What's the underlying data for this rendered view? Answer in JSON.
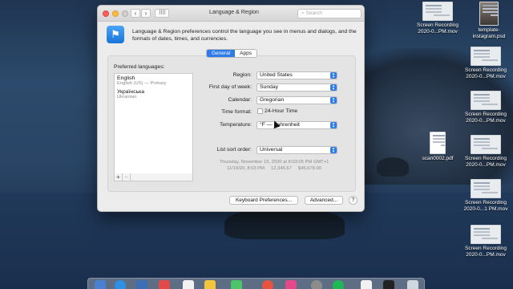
{
  "window": {
    "title": "Language & Region",
    "search_placeholder": "Search",
    "back_glyph": "‹",
    "forward_glyph": "›",
    "grid_glyph": "⠿⠿",
    "header_icon": "flag-globe-icon",
    "header_text": "Language & Region preferences control the language you see in menus and dialogs, and the formats of dates, times, and currencies."
  },
  "tabs": [
    {
      "label": "General",
      "active": true
    },
    {
      "label": "Apps",
      "active": false
    }
  ],
  "preferred_languages": {
    "label": "Preferred languages:",
    "items": [
      {
        "name": "English",
        "detail": "English (US) — Primary"
      },
      {
        "name": "Українська",
        "detail": "Ukrainian"
      }
    ],
    "add_glyph": "+",
    "remove_glyph": "−"
  },
  "settings": {
    "region": {
      "label": "Region:",
      "value": "United States"
    },
    "first_day": {
      "label": "First day of week:",
      "value": "Sunday"
    },
    "calendar": {
      "label": "Calendar:",
      "value": "Gregorian"
    },
    "time_format": {
      "label": "Time format:",
      "checkbox_label": "24-Hour Time",
      "checked": false
    },
    "temperature": {
      "label": "Temperature:",
      "value": "°F — Fahrenheit"
    },
    "list_sort": {
      "label": "List sort order:",
      "value": "Universal"
    }
  },
  "sample": {
    "line1": "Thursday, November 19, 2020 at 8:03:05 PM GMT+1",
    "line2": "11/19/20, 8:03 PM     12,345.67     $45,678.90"
  },
  "buttons": {
    "keyboard": "Keyboard Preferences...",
    "advanced": "Advanced...",
    "help": "?"
  },
  "desktop_icons": [
    {
      "label": "Screen Recording\n2020-0...PM.mov",
      "icon": "video-file-icon"
    },
    {
      "label": "template-\ninstagram.psd",
      "icon": "image-file-icon"
    },
    {
      "label": "Screen Recording\n2020-0...PM.mov",
      "icon": "video-file-icon"
    },
    {
      "label": "Screen Recording\n2020-0...PM.mov",
      "icon": "video-file-icon"
    },
    {
      "label": "scan0002.pdf",
      "icon": "pdf-file-icon"
    },
    {
      "label": "Screen Recording\n2020-0...PM.mov",
      "icon": "video-file-icon"
    },
    {
      "label": "Screen Recording\n2020-0...1 PM.mov",
      "icon": "video-file-icon"
    },
    {
      "label": "Screen Recording\n2020-0...PM.mov",
      "icon": "video-file-icon"
    }
  ],
  "colors": {
    "accent": "#2f7bea",
    "close": "#fc605b",
    "minimize": "#fdbc40"
  }
}
